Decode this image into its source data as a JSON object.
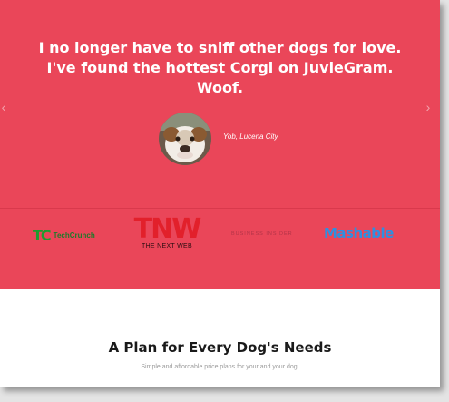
{
  "testimonial": {
    "quote": "I no longer have to sniff other dogs for love. I've found the hottest Corgi on JuvieGram. Woof.",
    "author": "Yob, Lucena City",
    "avatar_icon": "bulldog-avatar",
    "prev_arrow": "‹",
    "next_arrow": "›"
  },
  "press": {
    "techcrunch": {
      "mark": "TC",
      "text": "TechCrunch"
    },
    "tnw": {
      "mark": "TNW",
      "text": "THE NEXT WEB"
    },
    "business_insider": "BUSINESS INSIDER",
    "mashable": "Mashable"
  },
  "plans": {
    "title": "A Plan for Every Dog's Needs",
    "subtitle": "Simple and affordable price plans for your and your dog."
  },
  "colors": {
    "hero_bg": "#ea4659",
    "techcrunch": "#1f9b2f",
    "tnw": "#e2202b",
    "mashable": "#2e8fe0"
  }
}
